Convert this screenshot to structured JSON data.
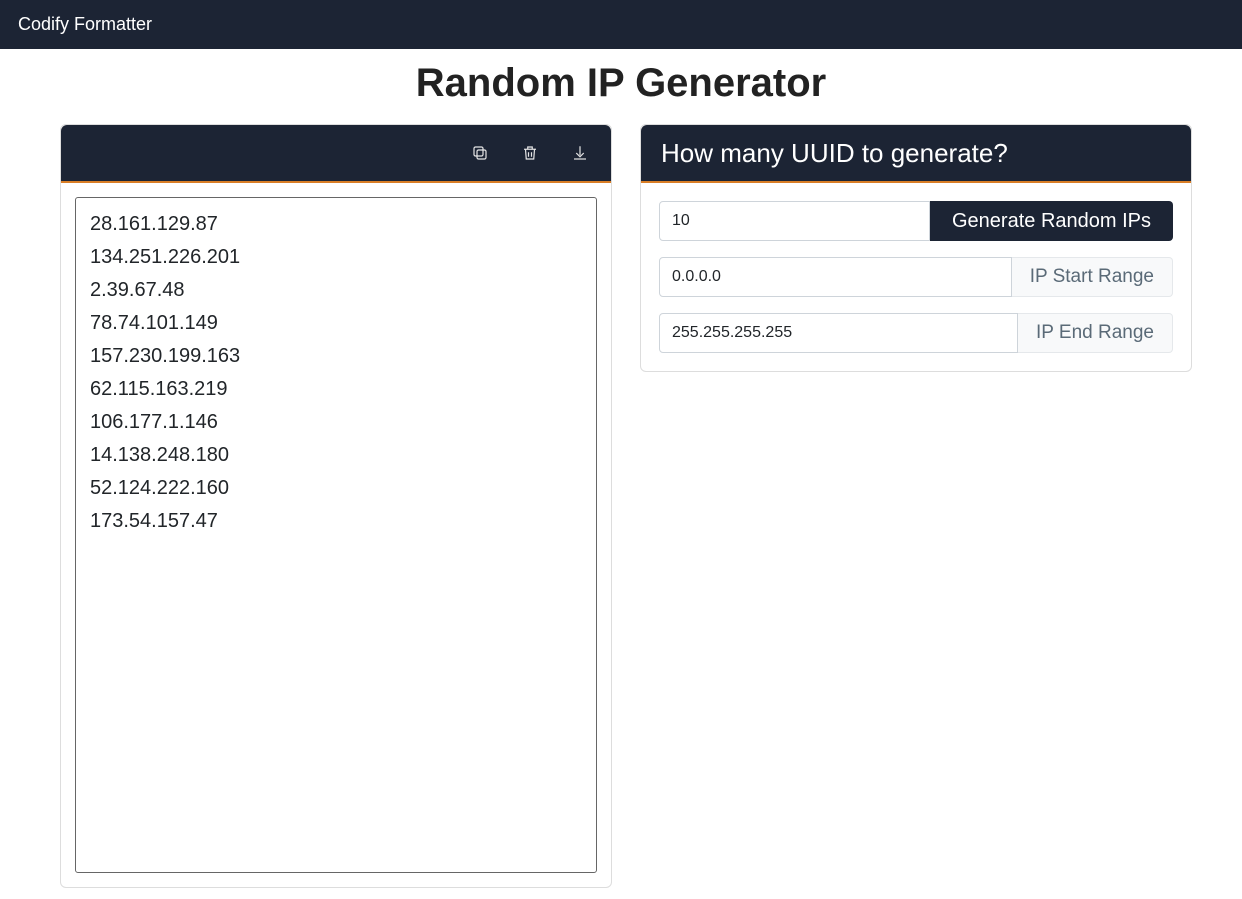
{
  "topbar": {
    "brand": "Codify Formatter"
  },
  "title": "Random IP Generator",
  "left_panel": {
    "output_lines": [
      "28.161.129.87",
      "134.251.226.201",
      "2.39.67.48",
      "78.74.101.149",
      "157.230.199.163",
      "62.115.163.219",
      "106.177.1.146",
      "14.138.248.180",
      "52.124.222.160",
      "173.54.157.47"
    ]
  },
  "right_panel": {
    "heading": "How many UUID to generate?",
    "count_value": "10",
    "generate_label": "Generate Random IPs",
    "start_range_value": "0.0.0.0",
    "start_range_label": "IP Start Range",
    "end_range_value": "255.255.255.255",
    "end_range_label": "IP End Range"
  }
}
